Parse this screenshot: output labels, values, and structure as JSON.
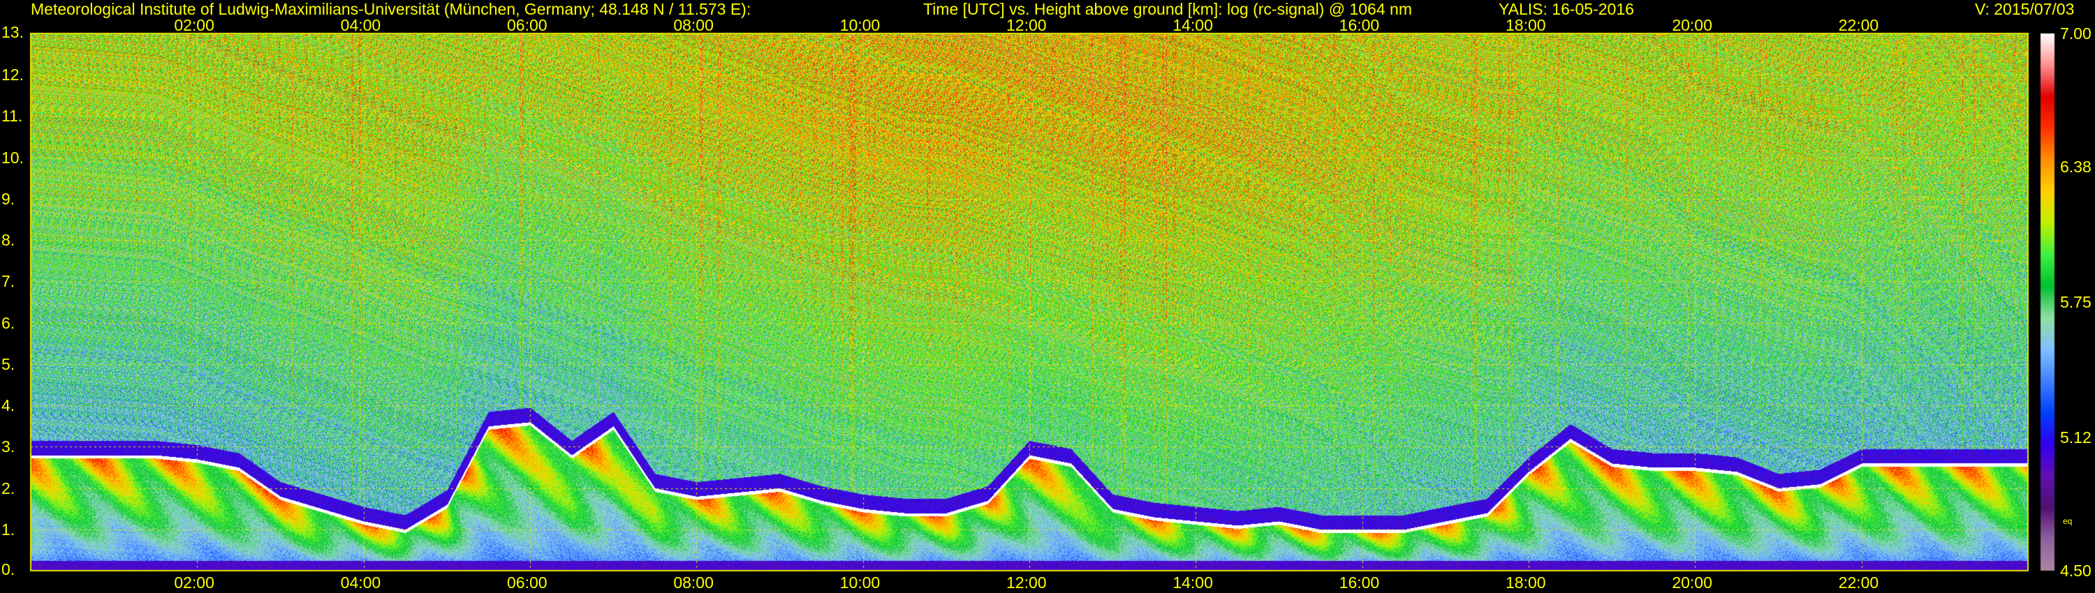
{
  "header": {
    "institute": "Meteorological Institute of Ludwig-Maximilians-Universität (München, Germany; 48.148 N / 11.573 E):",
    "description": "Time [UTC] vs. Height above ground [km]: log (rc-signal) @ 1064 nm",
    "instrument": "YALIS: 16-05-2016",
    "version": "V: 2015/07/03"
  },
  "colors": {
    "background": "#000000",
    "text": "#ffff00",
    "grid": "#e6e600"
  },
  "chart_data": {
    "type": "heatmap",
    "title": "Time [UTC] vs. Height above ground [km]: log (rc-signal) @ 1064 nm",
    "xlabel": "",
    "ylabel": "",
    "xlim": [
      0,
      24
    ],
    "ylim": [
      0,
      13
    ],
    "x_ticks": [
      {
        "value": 2,
        "label": "02:00"
      },
      {
        "value": 4,
        "label": "04:00"
      },
      {
        "value": 6,
        "label": "06:00"
      },
      {
        "value": 8,
        "label": "08:00"
      },
      {
        "value": 10,
        "label": "10:00"
      },
      {
        "value": 12,
        "label": "12:00"
      },
      {
        "value": 14,
        "label": "14:00"
      },
      {
        "value": 16,
        "label": "16:00"
      },
      {
        "value": 18,
        "label": "18:00"
      },
      {
        "value": 20,
        "label": "20:00"
      },
      {
        "value": 22,
        "label": "22:00"
      }
    ],
    "y_ticks": [
      {
        "value": 0,
        "label": "0."
      },
      {
        "value": 1,
        "label": "1."
      },
      {
        "value": 2,
        "label": "2."
      },
      {
        "value": 3,
        "label": "3."
      },
      {
        "value": 4,
        "label": "4."
      },
      {
        "value": 5,
        "label": "5."
      },
      {
        "value": 6,
        "label": "6."
      },
      {
        "value": 7,
        "label": "7."
      },
      {
        "value": 8,
        "label": "8."
      },
      {
        "value": 9,
        "label": "9."
      },
      {
        "value": 10,
        "label": "10."
      },
      {
        "value": 11,
        "label": "11."
      },
      {
        "value": 12,
        "label": "12."
      },
      {
        "value": 13,
        "label": "13."
      }
    ],
    "grid": true,
    "colorbar": {
      "range": [
        4.5,
        7.0
      ],
      "ticks": [
        {
          "value": 7.0,
          "label": "7.00"
        },
        {
          "value": 6.38,
          "label": "6.38"
        },
        {
          "value": 5.75,
          "label": "5.75"
        },
        {
          "value": 5.12,
          "label": "5.12"
        },
        {
          "value": 4.5,
          "label": "4.50"
        }
      ],
      "note": "eq",
      "stops": [
        "#a888a0",
        "#9060a0",
        "#501070",
        "#6010b0",
        "#3000f0",
        "#0040ff",
        "#4080ff",
        "#80c0ff",
        "#90e0a0",
        "#00c030",
        "#40f040",
        "#c0f000",
        "#ffd000",
        "#ff9000",
        "#ff3000",
        "#e00000",
        "#ff9090",
        "#ffffff"
      ]
    },
    "boundary_layer_top_km": {
      "time_utc": [
        0,
        1,
        1.5,
        2,
        2.5,
        3,
        3.5,
        4,
        4.5,
        5,
        5.5,
        6,
        6.5,
        7,
        7.5,
        8,
        8.5,
        9,
        9.5,
        10,
        10.5,
        11,
        11.5,
        12,
        12.5,
        13,
        13.5,
        14,
        14.5,
        15,
        15.5,
        16,
        16.5,
        17,
        17.5,
        18,
        18.5,
        19,
        19.5,
        20,
        20.5,
        21,
        21.5,
        22,
        22.5,
        23,
        23.5,
        24
      ],
      "height_km": [
        2.8,
        2.8,
        2.8,
        2.7,
        2.5,
        1.8,
        1.5,
        1.2,
        1.0,
        1.6,
        3.5,
        3.6,
        2.8,
        3.5,
        2.0,
        1.8,
        1.9,
        2.0,
        1.7,
        1.5,
        1.4,
        1.4,
        1.7,
        2.8,
        2.6,
        1.5,
        1.3,
        1.2,
        1.1,
        1.2,
        1.0,
        1.0,
        1.0,
        1.2,
        1.4,
        2.4,
        3.2,
        2.6,
        2.5,
        2.5,
        2.4,
        2.0,
        2.1,
        2.6,
        2.6,
        2.6,
        2.6,
        2.6
      ]
    }
  }
}
